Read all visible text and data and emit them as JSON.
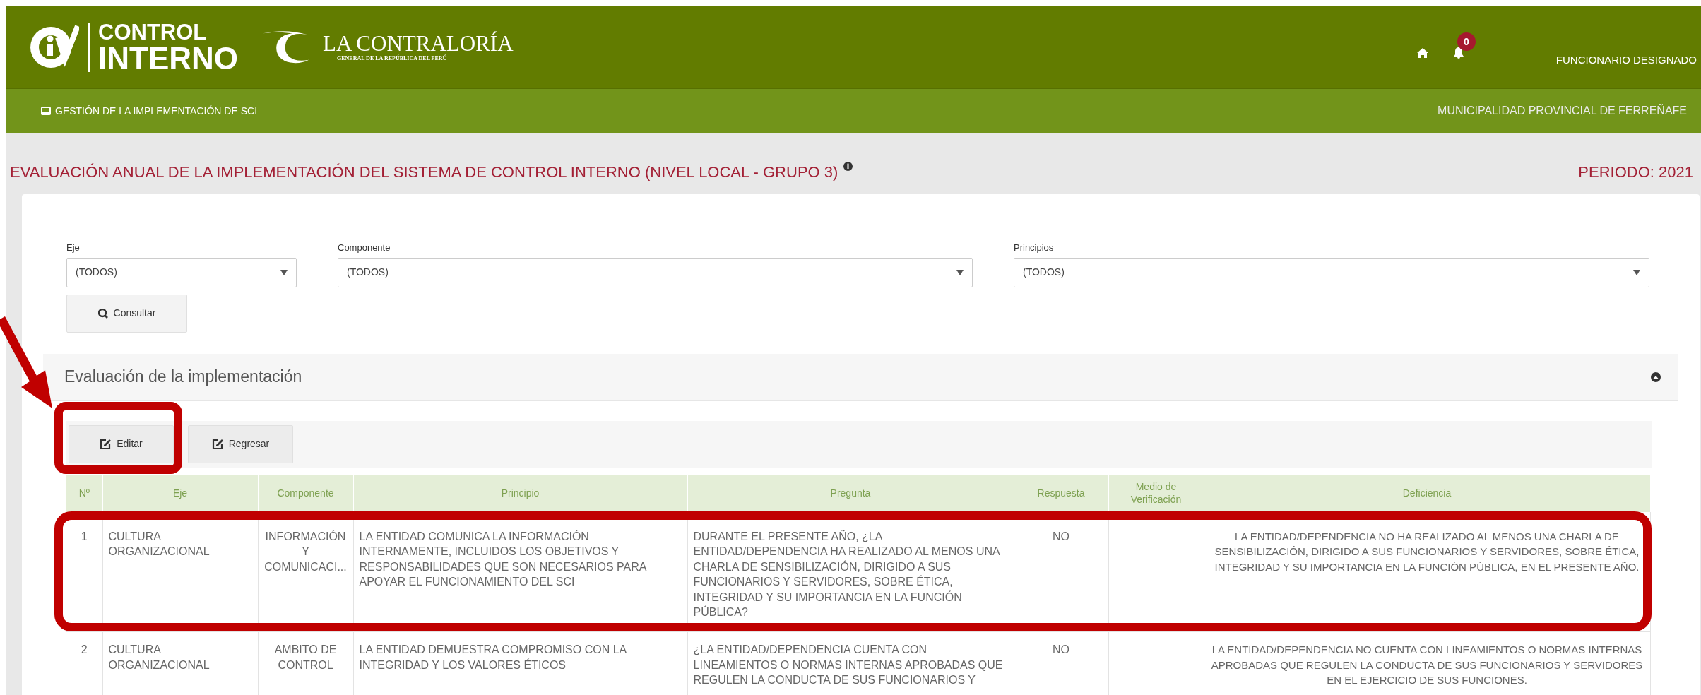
{
  "header": {
    "logo_lines": [
      "CONTROL",
      "INTERNO"
    ],
    "org_name": "LA CONTRALORÍA",
    "org_subtitle": "GENERAL DE LA REPÚBLICA DEL PERÚ",
    "notifications_count": "0",
    "user": "FUNCIONARIO DESIGNADO"
  },
  "subnav": {
    "module": "GESTIÓN DE LA IMPLEMENTACIÓN DE SCI",
    "entity": "MUNICIPALIDAD PROVINCIAL DE FERREÑAFE"
  },
  "page_title": "EVALUACIÓN ANUAL DE LA IMPLEMENTACIÓN DEL SISTEMA DE CONTROL INTERNO (NIVEL LOCAL - GRUPO 3)",
  "period": "PERIODO: 2021",
  "filters": [
    {
      "label": "Eje",
      "value": "(TODOS)"
    },
    {
      "label": "Componente",
      "value": "(TODOS)"
    },
    {
      "label": "Principios",
      "value": "(TODOS)"
    }
  ],
  "consult_button": "Consultar",
  "panel": {
    "title": "Evaluación de la implementación",
    "buttons": [
      "Editar",
      "Regresar"
    ],
    "columns": [
      "Nº",
      "Eje",
      "Componente",
      "Principio",
      "Pregunta",
      "Respuesta",
      "Medio de Verificación",
      "Deficiencia"
    ],
    "rows": [
      {
        "n": "1",
        "eje": "CULTURA ORGANIZACIONAL",
        "componente": "INFORMACIÓN Y COMUNICACI...",
        "principio": "LA ENTIDAD COMUNICA LA INFORMACIÓN INTERNAMENTE, INCLUIDOS LOS OBJETIVOS Y RESPONSABILIDADES QUE SON NECESARIOS PARA APOYAR EL FUNCIONAMIENTO DEL SCI",
        "pregunta": "DURANTE EL PRESENTE AÑO, ¿LA ENTIDAD/DEPENDENCIA HA REALIZADO AL MENOS UNA CHARLA DE SENSIBILIZACIÓN, DIRIGIDO A SUS FUNCIONARIOS Y SERVIDORES, SOBRE ÉTICA, INTEGRIDAD Y SU IMPORTANCIA EN LA FUNCIÓN PÚBLICA?",
        "respuesta": "NO",
        "deficiencia": "LA ENTIDAD/DEPENDENCIA NO HA REALIZADO AL MENOS UNA CHARLA DE SENSIBILIZACIÓN, DIRIGIDO A SUS FUNCIONARIOS Y SERVIDORES, SOBRE ÉTICA, INTEGRIDAD Y SU IMPORTANCIA EN LA FUNCIÓN PÚBLICA, EN EL PRESENTE AÑO."
      },
      {
        "n": "2",
        "eje": "CULTURA ORGANIZACIONAL",
        "componente": "AMBITO DE CONTROL",
        "principio": "LA ENTIDAD DEMUESTRA COMPROMISO CON LA INTEGRIDAD Y LOS VALORES ÉTICOS",
        "pregunta": "¿LA ENTIDAD/DEPENDENCIA CUENTA CON LINEAMIENTOS O NORMAS INTERNAS APROBADAS QUE REGULEN LA CONDUCTA DE SUS FUNCIONARIOS Y",
        "respuesta": "NO",
        "deficiencia": "LA ENTIDAD/DEPENDENCIA NO CUENTA CON LINEAMIENTOS O NORMAS INTERNAS APROBADAS QUE REGULEN LA CONDUCTA DE SUS FUNCIONARIOS Y SERVIDORES EN EL EJERCICIO DE SUS FUNCIONES."
      }
    ]
  }
}
